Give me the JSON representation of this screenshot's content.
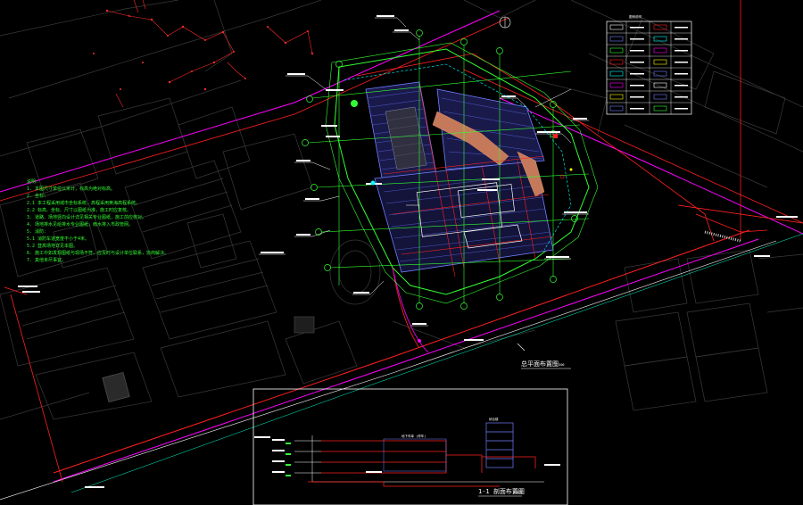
{
  "drawing": {
    "plan_title": "总平面布置图",
    "plan_scale": "1:500",
    "section_title": "1-1 剖面布置图",
    "section_scale": "1:500",
    "notes_heading": "说明：",
    "notes": [
      "1. 本图尺寸单位以米计，标高为绝对标高。",
      "2. 坐标：",
      "  2.1 本工程采用城市坐标系统，高程采用黄海高程系统。",
      "  2.2 标高、坐标、尺寸以图纸为准，施工时应复核。",
      "3. 道路、场地竖向设计详见相关专业图纸，施工前应核对。",
      "4. 场地排水见给排水专业图纸，雨水排入市政管网。",
      "5. 消防：",
      "  5.1 消防车道宽度不小于4米。",
      "  5.2 登高场地详见本图。",
      "6. 施工中如发现图纸与现场不符，应及时与设计单位联系，协商解决。",
      "7. 其他未尽事宜。"
    ],
    "legend_heading": "图例说明",
    "section_building_label": "地下车库 (停车)",
    "section_block_label": "综合楼"
  },
  "colors": {
    "background": "#000000",
    "context_lines": "#3c3c3c",
    "site_outline": "#33ff33",
    "road_red": "#ff2020",
    "road_magenta": "#ff00ff",
    "annotation_white": "#ffffff",
    "hatch_blue": "#6f7fff",
    "accent_orange": "#e0906a",
    "note_green": "#33ff33"
  }
}
